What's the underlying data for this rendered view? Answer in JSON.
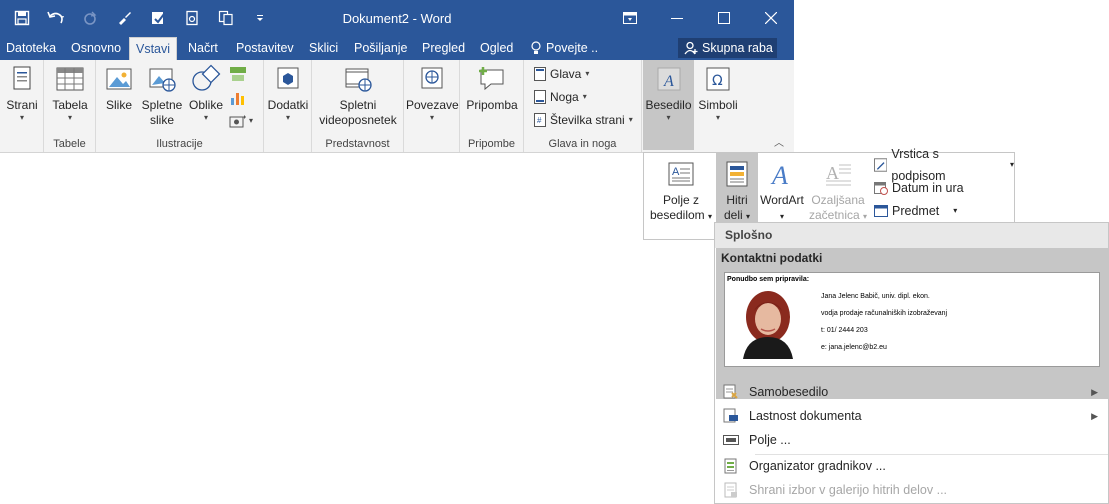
{
  "window": {
    "title": "Dokument2 - Word",
    "share_label": "Skupna raba"
  },
  "tabs": [
    {
      "label": "Datoteka"
    },
    {
      "label": "Osnovno"
    },
    {
      "label": "Vstavi",
      "active": true
    },
    {
      "label": "Načrt"
    },
    {
      "label": "Postavitev"
    },
    {
      "label": "Sklici"
    },
    {
      "label": "Pošiljanje"
    },
    {
      "label": "Pregled"
    },
    {
      "label": "Ogled"
    },
    {
      "label": "Povejte .."
    }
  ],
  "ribbon": {
    "strani": {
      "label": "Strani"
    },
    "tabele": {
      "tabela": "Tabela",
      "group": "Tabele"
    },
    "ilustracije": {
      "slike": "Slike",
      "spletne_1": "Spletne",
      "spletne_2": "slike",
      "oblike": "Oblike",
      "group": "Ilustracije"
    },
    "dodatki": {
      "label": "Dodatki"
    },
    "predstavnost": {
      "line1": "Spletni",
      "line2": "videoposnetek",
      "group": "Predstavnost"
    },
    "povezave": {
      "label": "Povezave"
    },
    "pripombe": {
      "label": "Pripomba",
      "group": "Pripombe"
    },
    "glava_noga": {
      "glava": "Glava",
      "noga": "Noga",
      "stevilka": "Številka strani",
      "group": "Glava in noga"
    },
    "besedilo": {
      "label": "Besedilo"
    },
    "simboli": {
      "label": "Simboli"
    }
  },
  "besedilo_panel": {
    "polje_1": "Polje z",
    "polje_2": "besedilom",
    "hitri_1": "Hitri",
    "hitri_2": "deli",
    "wordart": "WordArt",
    "ozaljsana_1": "Ozaljšana",
    "ozaljsana_2": "začetnica",
    "vrstica": "Vrstica s podpisom",
    "datum": "Datum in ura",
    "predmet": "Predmet"
  },
  "quick_parts": {
    "section": "Splošno",
    "gallery": {
      "title": "Kontaktni podatki",
      "intro": "Ponudbo sem pripravila:",
      "lines": [
        "Jana Jelenc Babič, univ. dipl. ekon.",
        "vodja prodaje računalniških izobraževanj",
        "t: 01/ 2444 203",
        "e: jana.jelenc@b2.eu"
      ]
    },
    "menu": [
      {
        "label": "Samobesedilo",
        "submenu": true
      },
      {
        "label": "Lastnost dokumenta",
        "submenu": true
      },
      {
        "label": "Polje ..."
      },
      {
        "label": "Organizator gradnikov ..."
      },
      {
        "label": "Shrani izbor v galerijo hitrih delov ...",
        "disabled": true
      }
    ]
  },
  "colors": {
    "titlebar": "#2b579a",
    "ribbon": "#f3f3f3",
    "accent": "#2b579a"
  }
}
